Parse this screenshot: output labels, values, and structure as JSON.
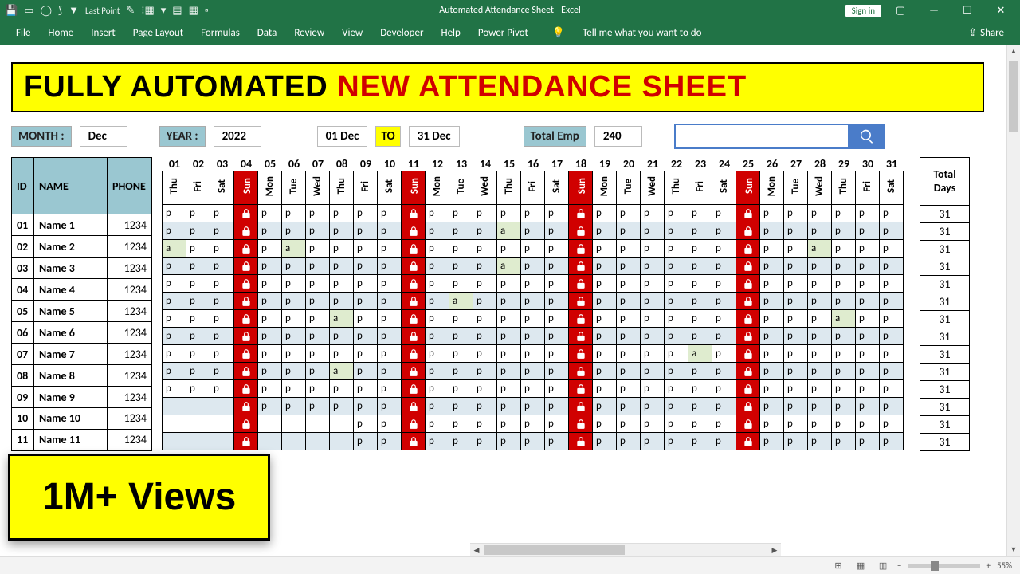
{
  "titlebar": {
    "qat_last_point": "Last Point",
    "title": "Automated Attendance Sheet  -  Excel",
    "signin": "Sign in"
  },
  "ribbon": [
    "File",
    "Home",
    "Insert",
    "Page Layout",
    "Formulas",
    "Data",
    "Review",
    "View",
    "Developer",
    "Help",
    "Power Pivot"
  ],
  "tellme": "Tell me what you want to do",
  "share": "Share",
  "headline": {
    "a": "FULLY AUTOMATED ",
    "b": "NEW ATTENDANCE  SHEET"
  },
  "controls": {
    "month_lbl": "MONTH :",
    "month_val": "Dec",
    "year_lbl": "YEAR :",
    "year_val": "2022",
    "from": "01 Dec",
    "to": "TO",
    "to_val": "31 Dec",
    "total_lbl": "Total Emp",
    "total_val": "240",
    "search_ph": ""
  },
  "emp_head": {
    "id": "ID",
    "name": "NAME",
    "phone": "PHONE"
  },
  "employees": [
    {
      "id": "01",
      "name": "Name 1",
      "phone": "1234"
    },
    {
      "id": "02",
      "name": "Name 2",
      "phone": "1234"
    },
    {
      "id": "03",
      "name": "Name 3",
      "phone": "1234"
    },
    {
      "id": "04",
      "name": "Name 4",
      "phone": "1234"
    },
    {
      "id": "05",
      "name": "Name 5",
      "phone": "1234"
    },
    {
      "id": "06",
      "name": "Name 6",
      "phone": "1234"
    },
    {
      "id": "07",
      "name": "Name 7",
      "phone": "1234"
    },
    {
      "id": "08",
      "name": "Name 8",
      "phone": "1234"
    },
    {
      "id": "09",
      "name": "Name 9",
      "phone": "1234"
    },
    {
      "id": "10",
      "name": "Name 10",
      "phone": "1234"
    },
    {
      "id": "11",
      "name": "Name 11",
      "phone": "1234"
    }
  ],
  "days": [
    {
      "num": "01",
      "name": "Thu",
      "sun": false
    },
    {
      "num": "02",
      "name": "Fri",
      "sun": false
    },
    {
      "num": "03",
      "name": "Sat",
      "sun": false
    },
    {
      "num": "04",
      "name": "Sun",
      "sun": true
    },
    {
      "num": "05",
      "name": "Mon",
      "sun": false
    },
    {
      "num": "06",
      "name": "Tue",
      "sun": false
    },
    {
      "num": "07",
      "name": "Wed",
      "sun": false
    },
    {
      "num": "08",
      "name": "Thu",
      "sun": false
    },
    {
      "num": "09",
      "name": "Fri",
      "sun": false
    },
    {
      "num": "10",
      "name": "Sat",
      "sun": false
    },
    {
      "num": "11",
      "name": "Sun",
      "sun": true
    },
    {
      "num": "12",
      "name": "Mon",
      "sun": false
    },
    {
      "num": "13",
      "name": "Tue",
      "sun": false
    },
    {
      "num": "14",
      "name": "Wed",
      "sun": false
    },
    {
      "num": "15",
      "name": "Thu",
      "sun": false
    },
    {
      "num": "16",
      "name": "Fri",
      "sun": false
    },
    {
      "num": "17",
      "name": "Sat",
      "sun": false
    },
    {
      "num": "18",
      "name": "Sun",
      "sun": true
    },
    {
      "num": "19",
      "name": "Mon",
      "sun": false
    },
    {
      "num": "20",
      "name": "Tue",
      "sun": false
    },
    {
      "num": "21",
      "name": "Wed",
      "sun": false
    },
    {
      "num": "22",
      "name": "Thu",
      "sun": false
    },
    {
      "num": "23",
      "name": "Fri",
      "sun": false
    },
    {
      "num": "24",
      "name": "Sat",
      "sun": false
    },
    {
      "num": "25",
      "name": "Sun",
      "sun": true
    },
    {
      "num": "26",
      "name": "Mon",
      "sun": false
    },
    {
      "num": "27",
      "name": "Tue",
      "sun": false
    },
    {
      "num": "28",
      "name": "Wed",
      "sun": false
    },
    {
      "num": "29",
      "name": "Thu",
      "sun": false
    },
    {
      "num": "30",
      "name": "Fri",
      "sun": false
    },
    {
      "num": "31",
      "name": "Sat",
      "sun": false
    }
  ],
  "attendance": [
    [
      "p",
      "p",
      "p",
      "L",
      "p",
      "p",
      "p",
      "p",
      "p",
      "p",
      "L",
      "p",
      "p",
      "p",
      "p",
      "p",
      "p",
      "L",
      "p",
      "p",
      "p",
      "p",
      "p",
      "p",
      "L",
      "p",
      "p",
      "p",
      "p",
      "p",
      "p"
    ],
    [
      "p",
      "p",
      "p",
      "L",
      "p",
      "p",
      "p",
      "p",
      "p",
      "p",
      "L",
      "p",
      "p",
      "p",
      "a",
      "p",
      "p",
      "L",
      "p",
      "p",
      "p",
      "p",
      "p",
      "p",
      "L",
      "p",
      "p",
      "p",
      "p",
      "p",
      "p"
    ],
    [
      "a",
      "p",
      "p",
      "L",
      "p",
      "a",
      "p",
      "p",
      "p",
      "p",
      "L",
      "p",
      "p",
      "p",
      "p",
      "p",
      "p",
      "L",
      "p",
      "p",
      "p",
      "p",
      "p",
      "p",
      "L",
      "p",
      "p",
      "a",
      "p",
      "p",
      "p"
    ],
    [
      "p",
      "p",
      "p",
      "L",
      "p",
      "p",
      "p",
      "p",
      "p",
      "p",
      "L",
      "p",
      "p",
      "p",
      "a",
      "p",
      "p",
      "L",
      "p",
      "p",
      "p",
      "p",
      "p",
      "p",
      "L",
      "p",
      "p",
      "p",
      "p",
      "p",
      "p"
    ],
    [
      "p",
      "p",
      "p",
      "L",
      "p",
      "p",
      "p",
      "p",
      "p",
      "p",
      "L",
      "p",
      "p",
      "p",
      "p",
      "p",
      "p",
      "L",
      "p",
      "p",
      "p",
      "p",
      "p",
      "p",
      "L",
      "p",
      "p",
      "p",
      "p",
      "p",
      "p"
    ],
    [
      "p",
      "p",
      "p",
      "L",
      "p",
      "p",
      "p",
      "p",
      "p",
      "p",
      "L",
      "p",
      "a",
      "p",
      "p",
      "p",
      "p",
      "L",
      "p",
      "p",
      "p",
      "p",
      "p",
      "p",
      "L",
      "p",
      "p",
      "p",
      "p",
      "p",
      "p"
    ],
    [
      "p",
      "p",
      "p",
      "L",
      "p",
      "p",
      "p",
      "a",
      "p",
      "p",
      "L",
      "p",
      "p",
      "p",
      "p",
      "p",
      "p",
      "L",
      "p",
      "p",
      "p",
      "p",
      "p",
      "p",
      "L",
      "p",
      "p",
      "p",
      "a",
      "p",
      "p"
    ],
    [
      "p",
      "p",
      "p",
      "L",
      "p",
      "p",
      "p",
      "p",
      "p",
      "p",
      "L",
      "p",
      "p",
      "p",
      "p",
      "p",
      "p",
      "L",
      "p",
      "p",
      "p",
      "p",
      "p",
      "p",
      "L",
      "p",
      "p",
      "p",
      "p",
      "p",
      "p"
    ],
    [
      "p",
      "p",
      "p",
      "L",
      "p",
      "p",
      "p",
      "p",
      "p",
      "p",
      "L",
      "p",
      "p",
      "p",
      "p",
      "p",
      "p",
      "L",
      "p",
      "p",
      "p",
      "p",
      "a",
      "p",
      "L",
      "p",
      "p",
      "p",
      "p",
      "p",
      "p"
    ],
    [
      "p",
      "p",
      "p",
      "L",
      "p",
      "p",
      "p",
      "a",
      "p",
      "p",
      "L",
      "p",
      "p",
      "p",
      "p",
      "p",
      "p",
      "L",
      "p",
      "p",
      "p",
      "p",
      "p",
      "p",
      "L",
      "p",
      "p",
      "p",
      "p",
      "p",
      "p"
    ],
    [
      "p",
      "p",
      "p",
      "L",
      "p",
      "p",
      "p",
      "p",
      "p",
      "p",
      "L",
      "p",
      "p",
      "p",
      "p",
      "p",
      "p",
      "L",
      "p",
      "p",
      "p",
      "p",
      "p",
      "p",
      "L",
      "p",
      "p",
      "p",
      "p",
      "p",
      "p"
    ],
    [
      "",
      "",
      "",
      "L",
      "p",
      "p",
      "p",
      "p",
      "p",
      "p",
      "L",
      "p",
      "p",
      "p",
      "p",
      "p",
      "p",
      "L",
      "p",
      "p",
      "p",
      "p",
      "p",
      "p",
      "L",
      "p",
      "p",
      "p",
      "p",
      "p",
      "p"
    ],
    [
      "",
      "",
      "",
      "L",
      "",
      "",
      "",
      "",
      "p",
      "p",
      "L",
      "p",
      "p",
      "p",
      "p",
      "p",
      "p",
      "L",
      "p",
      "p",
      "p",
      "p",
      "p",
      "p",
      "L",
      "p",
      "p",
      "p",
      "p",
      "p",
      "p"
    ],
    [
      "",
      "",
      "",
      "L",
      "",
      "",
      "",
      "",
      "p",
      "p",
      "L",
      "p",
      "p",
      "p",
      "p",
      "p",
      "p",
      "L",
      "p",
      "p",
      "p",
      "p",
      "p",
      "p",
      "L",
      "p",
      "p",
      "p",
      "p",
      "p",
      "p"
    ]
  ],
  "total_head": "Total Days",
  "totals": [
    "31",
    "31",
    "31",
    "31",
    "31",
    "31",
    "31",
    "31",
    "31",
    "31",
    "31",
    "31",
    "31",
    "31"
  ],
  "overlay": "1M+ Views",
  "zoom": "55%"
}
